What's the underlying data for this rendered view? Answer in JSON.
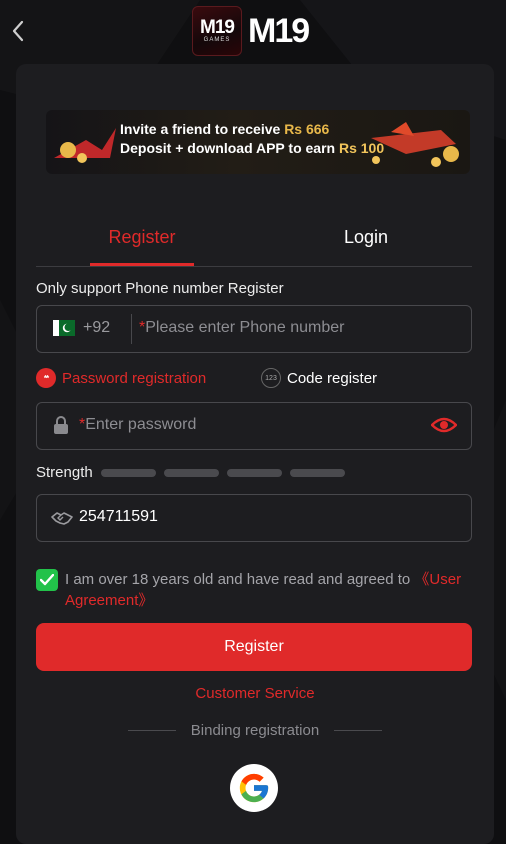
{
  "header": {
    "logo_badge_text": "M19",
    "logo_badge_sub": "GAMES",
    "logo_text": "M19"
  },
  "banner": {
    "line1_prefix": "Invite a friend to receive",
    "line1_amount": "Rs 666",
    "line2_prefix": "Deposit + download APP to earn",
    "line2_amount": "Rs 100"
  },
  "tabs": [
    {
      "label": "Register",
      "active": true
    },
    {
      "label": "Login",
      "active": false
    }
  ],
  "register": {
    "note": "Only support Phone number Register",
    "phone": {
      "country_code": "+92",
      "placeholder_star": "*",
      "placeholder": "Please enter Phone number"
    },
    "modes": {
      "password_label": "Password registration",
      "code_label": "Code register",
      "password_icon": "**",
      "code_icon": "123"
    },
    "password": {
      "placeholder_star": "*",
      "placeholder": "Enter password"
    },
    "strength_label": "Strength",
    "strength_level": 0,
    "referral_code": "254711591",
    "agreement": {
      "checked": true,
      "text": "I am over 18 years old and have read and agreed to ",
      "link": "《User Agreement》"
    },
    "submit_label": "Register",
    "customer_service": "Customer Service",
    "binding": "Binding registration"
  },
  "colors": {
    "accent": "#e02a2a",
    "check": "#22c24a",
    "card": "#1d1d20",
    "background": "#0f0f11"
  },
  "icons": [
    "back-arrow-icon",
    "pakistan-flag-icon",
    "lock-icon",
    "eye-icon",
    "handshake-icon",
    "checkmark-icon",
    "google-icon"
  ]
}
